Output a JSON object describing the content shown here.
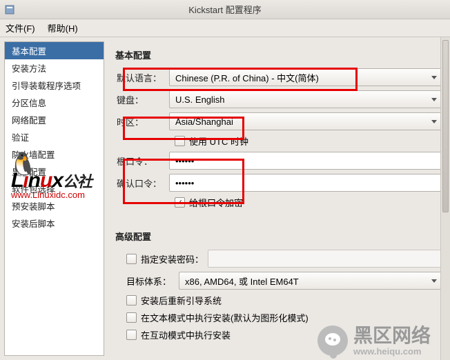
{
  "window": {
    "title": "Kickstart 配置程序"
  },
  "menu": {
    "file": "文件(F)",
    "help": "帮助(H)"
  },
  "sidebar": {
    "items": [
      "基本配置",
      "安装方法",
      "引导装载程序选项",
      "分区信息",
      "网络配置",
      "验证",
      "防火墙配置",
      "显示配置",
      "软件包选择",
      "预安装脚本",
      "安装后脚本"
    ]
  },
  "form": {
    "section_basic": "基本配置",
    "default_lang_label": "默认语言：",
    "default_lang_value": "Chinese (P.R. of China) - 中文(简体)",
    "keyboard_label": "键盘：",
    "keyboard_value": "U.S. English",
    "timezone_label": "时区：",
    "timezone_value": "Asia/Shanghai",
    "utc_label": "使用 UTC 时钟",
    "rootpw_label": "根口令：",
    "rootpw_value": "••••••",
    "confirmpw_label": "确认口令：",
    "confirmpw_value": "••••••",
    "encrypt_label": "给根口令加密",
    "section_adv": "高级配置",
    "install_pw_label": "指定安装密码：",
    "install_pw_value": "",
    "target_arch_label": "目标体系：",
    "target_arch_value": "x86, AMD64, 或 Intel EM64T",
    "reboot_label": "安装后重新引导系统",
    "textmode_label": "在文本模式中执行安装(默认为图形化模式)",
    "interactive_label": "在互动模式中执行安装"
  },
  "watermarks": {
    "linux_big": "Linux公社",
    "linux_url": "www.Linuxidc.com",
    "heiqu_text": "黑区网络",
    "heiqu_url": "www.heiqu.com"
  }
}
